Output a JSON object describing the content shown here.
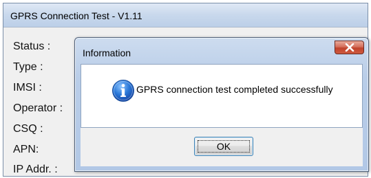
{
  "main_window": {
    "title": "GPRS Connection Test - V1.11",
    "fields": [
      {
        "label": "Status :"
      },
      {
        "label": "Type :"
      },
      {
        "label": "IMSI :"
      },
      {
        "label": "Operator :"
      },
      {
        "label": "CSQ :"
      },
      {
        "label": "APN:"
      },
      {
        "label": "IP Addr. :"
      }
    ]
  },
  "dialog": {
    "title": "Information",
    "close_icon": "close-x-icon",
    "icon": "information-icon",
    "message": "GPRS connection test completed successfully",
    "ok_label": "OK"
  },
  "colors": {
    "titlebar": "#c8d8ec",
    "close_button": "#c0432c",
    "info_icon_blue": "#1e64c8",
    "ok_border": "#3c7fb1"
  }
}
